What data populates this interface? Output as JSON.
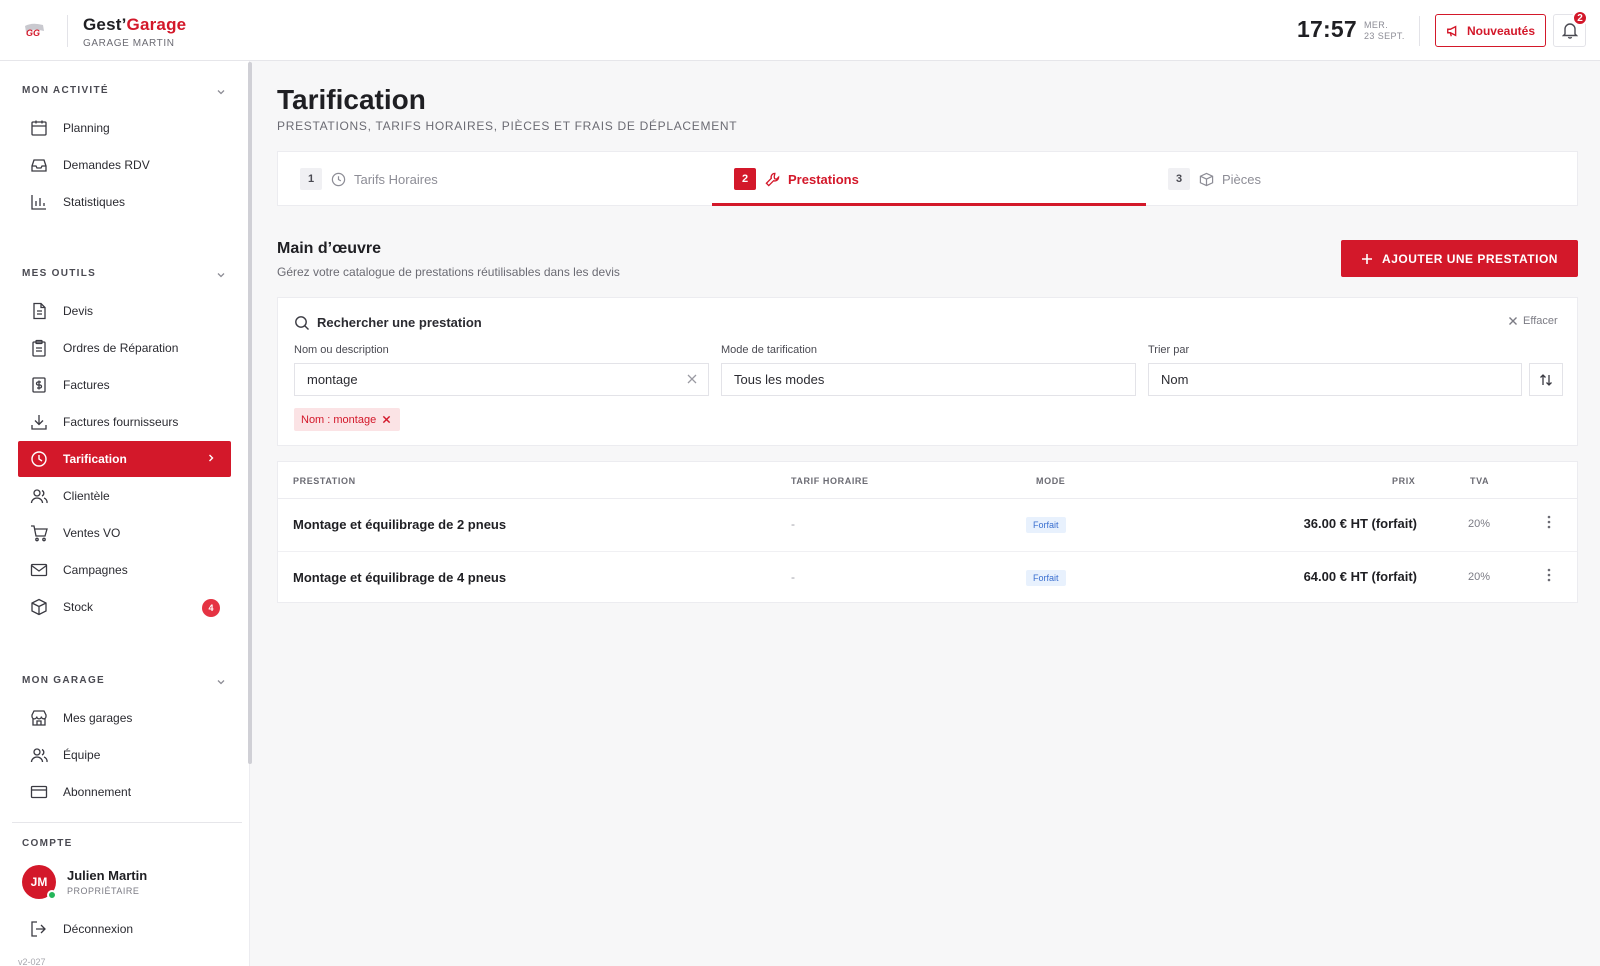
{
  "brand": {
    "name_part1": "Gest’",
    "name_part2": "Garage",
    "garage": "GARAGE MARTIN"
  },
  "header": {
    "time": "17:57",
    "day": "MER.",
    "date": "23 SEPT.",
    "news_label": "Nouveautés",
    "notif_count": "2"
  },
  "sidebar": {
    "sections": [
      {
        "title": "MON ACTIVITÉ",
        "items": [
          {
            "label": "Planning",
            "icon": "calendar-icon"
          },
          {
            "label": "Demandes RDV",
            "icon": "inbox-icon"
          },
          {
            "label": "Statistiques",
            "icon": "bar-chart-icon"
          }
        ]
      },
      {
        "title": "MES OUTILS",
        "items": [
          {
            "label": "Devis",
            "icon": "document-icon"
          },
          {
            "label": "Ordres de Réparation",
            "icon": "clipboard-icon"
          },
          {
            "label": "Factures",
            "icon": "invoice-dollar-icon"
          },
          {
            "label": "Factures fournisseurs",
            "icon": "download-icon"
          },
          {
            "label": "Tarification",
            "icon": "clock-icon",
            "active": true
          },
          {
            "label": "Clientèle",
            "icon": "users-icon"
          },
          {
            "label": "Ventes VO",
            "icon": "cart-icon"
          },
          {
            "label": "Campagnes",
            "icon": "mail-icon"
          },
          {
            "label": "Stock",
            "icon": "box-icon",
            "badge": "4"
          }
        ]
      },
      {
        "title": "MON GARAGE",
        "items": [
          {
            "label": "Mes garages",
            "icon": "store-icon"
          },
          {
            "label": "Équipe",
            "icon": "team-icon"
          },
          {
            "label": "Abonnement",
            "icon": "card-icon"
          }
        ]
      }
    ],
    "account": {
      "title": "COMPTE",
      "initials": "JM",
      "name": "Julien Martin",
      "role": "PROPRIÉTAIRE",
      "logout": "Déconnexion"
    },
    "version": "v2-027"
  },
  "page": {
    "title": "Tarification",
    "subtitle": "PRESTATIONS, TARIFS HORAIRES, PIÈCES ET FRAIS DE DÉPLACEMENT",
    "tabs": [
      {
        "num": "1",
        "label": "Tarifs Horaires",
        "icon": "clock-icon"
      },
      {
        "num": "2",
        "label": "Prestations",
        "icon": "wrench-icon",
        "active": true
      },
      {
        "num": "3",
        "label": "Pièces",
        "icon": "box-icon"
      }
    ],
    "section_title": "Main d’œuvre",
    "section_desc": "Gérez votre catalogue de prestations réutilisables dans les devis",
    "add_button": "AJOUTER UNE PRESTATION"
  },
  "filters": {
    "search_title": "Rechercher une prestation",
    "clear_label": "Effacer",
    "name_label": "Nom ou description",
    "name_value": "montage",
    "mode_label": "Mode de tarification",
    "mode_value": "Tous les modes",
    "sort_label": "Trier par",
    "sort_value": "Nom",
    "chip": "Nom : montage"
  },
  "table": {
    "headers": {
      "prestation": "PRESTATION",
      "tarif": "TARIF HORAIRE",
      "mode": "MODE",
      "prix": "PRIX",
      "tva": "TVA"
    },
    "rows": [
      {
        "name": "Montage et équilibrage de 2 pneus",
        "tarif": "-",
        "mode": "Forfait",
        "price": "36.00 € HT (forfait)",
        "tva": "20%"
      },
      {
        "name": "Montage et équilibrage de 4 pneus",
        "tarif": "-",
        "mode": "Forfait",
        "price": "64.00 € HT (forfait)",
        "tva": "20%"
      }
    ]
  },
  "colors": {
    "accent": "#d3182a",
    "mode_badge_bg": "#e8f1fd",
    "online": "#25b65a"
  }
}
